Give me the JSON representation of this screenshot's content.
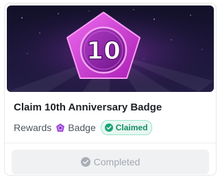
{
  "badge": {
    "emblem_text": "10",
    "title": "Claim 10th Anniversary Badge"
  },
  "reward": {
    "label": "Rewards",
    "type": "Badge",
    "icon": "badge-gem-icon"
  },
  "status": {
    "label": "Claimed",
    "icon": "check-circle-icon",
    "color": "#178a63"
  },
  "action": {
    "label": "Completed",
    "icon": "check-circle-icon",
    "disabled": true
  },
  "colors": {
    "badge_magenta": "#d23ad8",
    "banner_bg": "#14122e"
  }
}
